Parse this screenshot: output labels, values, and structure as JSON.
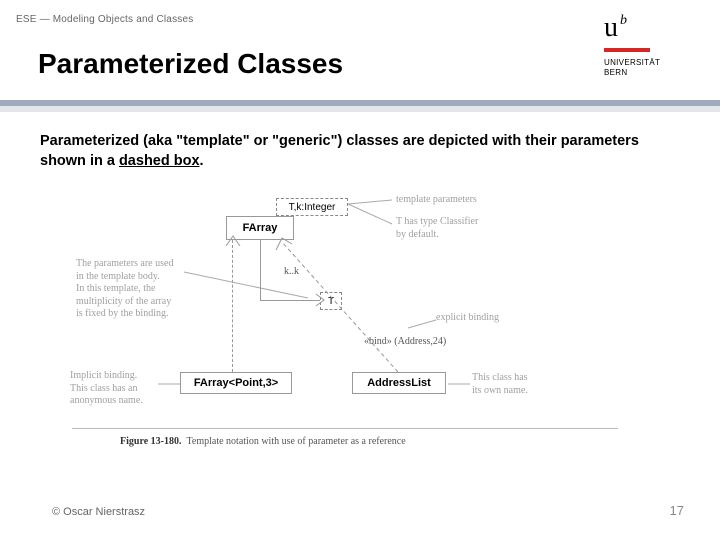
{
  "header": {
    "course": "ESE — Modeling Objects and Classes"
  },
  "logo": {
    "u": "u",
    "sup": "b",
    "line1": "UNIVERSITÄT",
    "line2": "BERN"
  },
  "title": "Parameterized Classes",
  "body": {
    "prefix": "Parameterized (aka \"template\" or \"generic\") classes are depicted with their parameters shown in a ",
    "underlined": "dashed box",
    "suffix": "."
  },
  "diagram": {
    "farray": "FArray",
    "params": "T,k:Integer",
    "t": "T",
    "kk": "k..k",
    "farray_bound": "FArray<Point,3>",
    "address_list": "AddressList",
    "bind": "«bind» (Address,24)",
    "note_params_use_1": "The parameters are used",
    "note_params_use_2": "in the template body.",
    "note_params_use_3": "In this template, the",
    "note_params_use_4": "multiplicity of the array",
    "note_params_use_5": "is fixed by the binding.",
    "note_template_params": "template parameters",
    "note_t_default_1": "T has type Classifier",
    "note_t_default_2": "by default.",
    "note_explicit": "explicit binding",
    "note_implicit_1": "Implicit binding.",
    "note_implicit_2": "This class has an",
    "note_implicit_3": "anonymous name.",
    "note_own_1": "This class has",
    "note_own_2": "its own name."
  },
  "figure": {
    "num": "Figure 13-180.",
    "caption": "Template notation with use of parameter as a reference"
  },
  "footer": {
    "copyright": "© Oscar Nierstrasz",
    "page": "17"
  }
}
